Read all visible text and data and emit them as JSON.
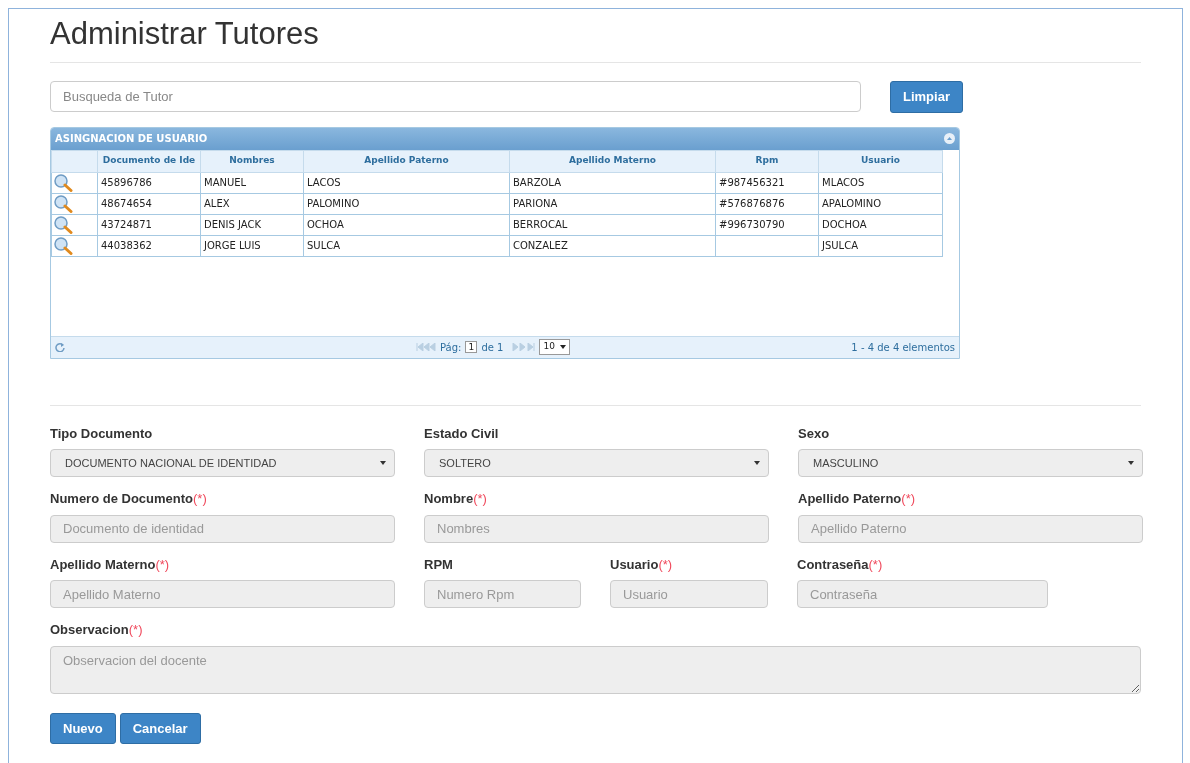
{
  "title": "Administrar Tutores",
  "search": {
    "placeholder": "Busqueda de Tutor",
    "button": "Limpiar"
  },
  "grid": {
    "caption": "ASINGNACION DE USUARIO",
    "columns": [
      "Documento de Ide",
      "Nombres",
      "Apellido Paterno",
      "Apellido Materno",
      "Rpm",
      "Usuario"
    ],
    "rows": [
      {
        "cells": [
          "45896786",
          "MANUEL",
          "LACOS",
          "BARZOLA",
          "#987456321",
          "MLACOS"
        ]
      },
      {
        "cells": [
          "48674654",
          "ALEX",
          "PALOMINO",
          "PARIONA",
          "#576876876",
          "APALOMINO"
        ]
      },
      {
        "cells": [
          "43724871",
          "DENIS JACK",
          "OCHOA",
          "BERROCAL",
          "#996730790",
          "DOCHOA"
        ]
      },
      {
        "cells": [
          "44038362",
          "JORGE LUIS",
          "SULCA",
          "CONZALEZ",
          "",
          "JSULCA"
        ]
      }
    ],
    "pager": {
      "page_label": "Pág:",
      "page": "1",
      "of": "de 1",
      "page_size": "10",
      "summary": "1 - 4 de 4 elementos"
    }
  },
  "form": {
    "rows": [
      [
        {
          "kind": "select",
          "label": "Tipo Documento",
          "value": "DOCUMENTO NACIONAL DE IDENTIDAD"
        },
        {
          "kind": "select",
          "label": "Estado Civil",
          "value": "SOLTERO"
        },
        {
          "kind": "select",
          "label": "Sexo",
          "value": "MASCULINO"
        }
      ],
      [
        {
          "kind": "input",
          "label": "Numero de Documento",
          "required": "(*)",
          "placeholder": "Documento de identidad"
        },
        {
          "kind": "input",
          "label": "Nombre",
          "required": "(*)",
          "placeholder": "Nombres"
        },
        {
          "kind": "input",
          "label": "Apellido Paterno",
          "required": "(*)",
          "placeholder": "Apellido Paterno"
        }
      ],
      [
        {
          "kind": "input",
          "label": "Apellido Materno",
          "required": "(*)",
          "placeholder": "Apellido Materno"
        },
        {
          "kind": "input",
          "label": "RPM",
          "placeholder": "Numero Rpm"
        },
        {
          "kind": "input",
          "label": "Usuario",
          "required": "(*)",
          "placeholder": "Usuario"
        },
        {
          "kind": "input",
          "label": "Contraseña",
          "required": "(*)",
          "placeholder": "Contraseña"
        }
      ],
      [
        {
          "kind": "textarea",
          "label": "Observacion",
          "required": "(*)",
          "placeholder": "Observacion del docente"
        }
      ]
    ],
    "buttons": [
      "Nuevo",
      "Cancelar"
    ]
  }
}
